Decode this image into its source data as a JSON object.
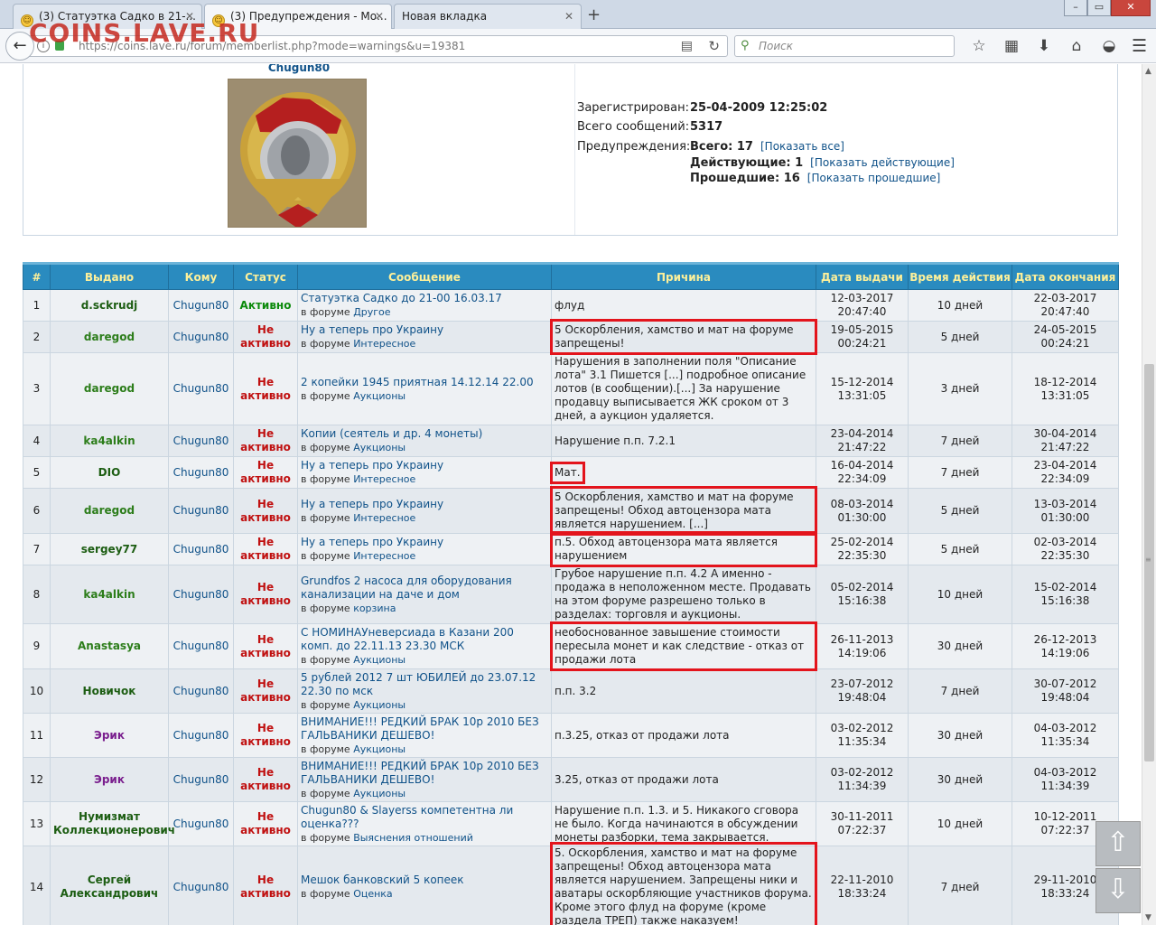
{
  "browser": {
    "tabs": [
      {
        "label": "(3) Статуэтка Садко в 21-...",
        "active": false
      },
      {
        "label": "(3) Предупреждения - Мо...",
        "active": true
      },
      {
        "label": "Новая вкладка",
        "active": false
      }
    ],
    "url": "https://coins.lave.ru/forum/memberlist.php?mode=warnings&u=19381",
    "search_placeholder": "Поиск",
    "watermark": "COINS.LAVE.RU"
  },
  "profile": {
    "username": "Chugun80",
    "registered_label": "Зарегистрирован:",
    "registered_value": "25-04-2009 12:25:02",
    "posts_label": "Всего сообщений:",
    "posts_value": "5317",
    "warnings_label": "Предупреждения:",
    "total_label": "Всего: 17",
    "show_all": "[Показать все]",
    "active_label": "Действующие: 1",
    "show_active": "[Показать действующие]",
    "past_label": "Прошедшие: 16",
    "show_past": "[Показать прошедшие]"
  },
  "table": {
    "headers": [
      "#",
      "Выдано",
      "Кому",
      "Статус",
      "Сообщение",
      "Причина",
      "Дата выдачи",
      "Время действия",
      "Дата окончания"
    ],
    "forum_prefix": "в форуме",
    "rows": [
      {
        "num": "1",
        "issuer": "d.sckrudj",
        "whom": "Chugun80",
        "status": "Активно",
        "post": "Статуэтка Садко до 21-00 16.03.17",
        "forum": "Другое",
        "reason": "флуд",
        "issued": "12-03-2017 20:47:40",
        "duration": "10 дней",
        "ends": "22-03-2017 20:47:40"
      },
      {
        "num": "2",
        "issuer": "daregod",
        "whom": "Chugun80",
        "status": "Не активно",
        "post": "Ну а теперь про Украину",
        "forum": "Интересное",
        "reason": "5 Оскорбления, хамство и мат на форуме запрещены!",
        "issued": "19-05-2015 00:24:21",
        "duration": "5 дней",
        "ends": "24-05-2015 00:24:21"
      },
      {
        "num": "3",
        "issuer": "daregod",
        "whom": "Chugun80",
        "status": "Не активно",
        "post": "2 копейки 1945 приятная 14.12.14 22.00",
        "forum": "Аукционы",
        "reason": "Нарушения в заполнении поля \"Описание лота\" 3.1 Пишется [...] подробное описание лотов (в сообщении).[...] За нарушение продавцу выписывается ЖК сроком от 3 дней, а аукцион удаляется.",
        "issued": "15-12-2014 13:31:05",
        "duration": "3 дней",
        "ends": "18-12-2014 13:31:05"
      },
      {
        "num": "4",
        "issuer": "ka4alkin",
        "whom": "Chugun80",
        "status": "Не активно",
        "post": "Копии (сеятель и др. 4 монеты)",
        "forum": "Аукционы",
        "reason": "Нарушение п.п. 7.2.1",
        "issued": "23-04-2014 21:47:22",
        "duration": "7 дней",
        "ends": "30-04-2014 21:47:22"
      },
      {
        "num": "5",
        "issuer": "DIO",
        "whom": "Chugun80",
        "status": "Не активно",
        "post": "Ну а теперь про Украину",
        "forum": "Интересное",
        "reason": "Мат.",
        "issued": "16-04-2014 22:34:09",
        "duration": "7 дней",
        "ends": "23-04-2014 22:34:09"
      },
      {
        "num": "6",
        "issuer": "daregod",
        "whom": "Chugun80",
        "status": "Не активно",
        "post": "Ну а теперь про Украину",
        "forum": "Интересное",
        "reason": "5 Оскорбления, хамство и мат на форуме запрещены! Обход автоцензора мата является нарушением. [...]",
        "issued": "08-03-2014 01:30:00",
        "duration": "5 дней",
        "ends": "13-03-2014 01:30:00"
      },
      {
        "num": "7",
        "issuer": "sergey77",
        "whom": "Chugun80",
        "status": "Не активно",
        "post": "Ну а теперь про Украину",
        "forum": "Интересное",
        "reason": "п.5. Обход автоцензора мата является нарушением",
        "issued": "25-02-2014 22:35:30",
        "duration": "5 дней",
        "ends": "02-03-2014 22:35:30"
      },
      {
        "num": "8",
        "issuer": "ka4alkin",
        "whom": "Chugun80",
        "status": "Не активно",
        "post": "Grundfos 2 насоса для оборудования канализации на даче и дом",
        "forum": "корзина",
        "reason": "Грубое нарушение п.п. 4.2 А именно - продажа в неположенном месте. Продавать на этом форуме разрешено только в разделах: торговля и аукционы.",
        "issued": "05-02-2014 15:16:38",
        "duration": "10 дней",
        "ends": "15-02-2014 15:16:38"
      },
      {
        "num": "9",
        "issuer": "Anastasya",
        "whom": "Chugun80",
        "status": "Не активно",
        "post": "С НОМИНАУневерсиада в Казани 200 комп. до 22.11.13 23.30 МСК",
        "forum": "Аукционы",
        "reason": "необоснованное завышение стоимости пересыла монет и как следствие - отказ от продажи лота",
        "issued": "26-11-2013 14:19:06",
        "duration": "30 дней",
        "ends": "26-12-2013 14:19:06"
      },
      {
        "num": "10",
        "issuer": "Новичок",
        "whom": "Chugun80",
        "status": "Не активно",
        "post": "5 рублей 2012 7 шт ЮБИЛЕЙ до 23.07.12 22.30 по мск",
        "forum": "Аукционы",
        "reason": "п.п. 3.2",
        "issued": "23-07-2012 19:48:04",
        "duration": "7 дней",
        "ends": "30-07-2012 19:48:04"
      },
      {
        "num": "11",
        "issuer": "Эрик",
        "whom": "Chugun80",
        "status": "Не активно",
        "post": "ВНИМАНИЕ!!! РЕДКИЙ БРАК 10р 2010 БЕЗ ГАЛЬВАНИКИ ДЕШЕВО!",
        "forum": "Аукционы",
        "reason": "п.3.25, отказ от продажи лота",
        "issued": "03-02-2012 11:35:34",
        "duration": "30 дней",
        "ends": "04-03-2012 11:35:34"
      },
      {
        "num": "12",
        "issuer": "Эрик",
        "whom": "Chugun80",
        "status": "Не активно",
        "post": "ВНИМАНИЕ!!! РЕДКИЙ БРАК 10р 2010 БЕЗ ГАЛЬВАНИКИ ДЕШЕВО!",
        "forum": "Аукционы",
        "reason": "3.25, отказ от продажи лота",
        "issued": "03-02-2012 11:34:39",
        "duration": "30 дней",
        "ends": "04-03-2012 11:34:39"
      },
      {
        "num": "13",
        "issuer": "Нумизмат Коллекционерович",
        "whom": "Chugun80",
        "status": "Не активно",
        "post": "Chugun80 & Slayerss компетентна ли оценка???",
        "forum": "Выяснения отношений",
        "reason": "Нарушение п.п. 1.3. и 5. Никакого сговора не было. Когда начинаются в обсуждении монеты разборки, тема закрывается.",
        "issued": "30-11-2011 07:22:37",
        "duration": "10 дней",
        "ends": "10-12-2011 07:22:37"
      },
      {
        "num": "14",
        "issuer": "Сергей Александрович",
        "whom": "Chugun80",
        "status": "Не активно",
        "post": "Мешок банковский 5 копеек",
        "forum": "Оценка",
        "reason": "5. Оскорбления, хамство и мат на форуме запрещены! Обход автоцензора мата является нарушением. Запрещены ники и аватары оскорбляющие участников форума. Кроме этого флуд на форуме (кроме раздела ТРЕП) также наказуем!",
        "issued": "22-11-2010 18:33:24",
        "duration": "7 дней",
        "ends": "29-11-2010 18:33:24"
      }
    ]
  },
  "colors": {
    "header_bg": "#2a8bbf",
    "header_text": "#fdf09a",
    "highlight": "#e3141c",
    "link": "#105289"
  }
}
